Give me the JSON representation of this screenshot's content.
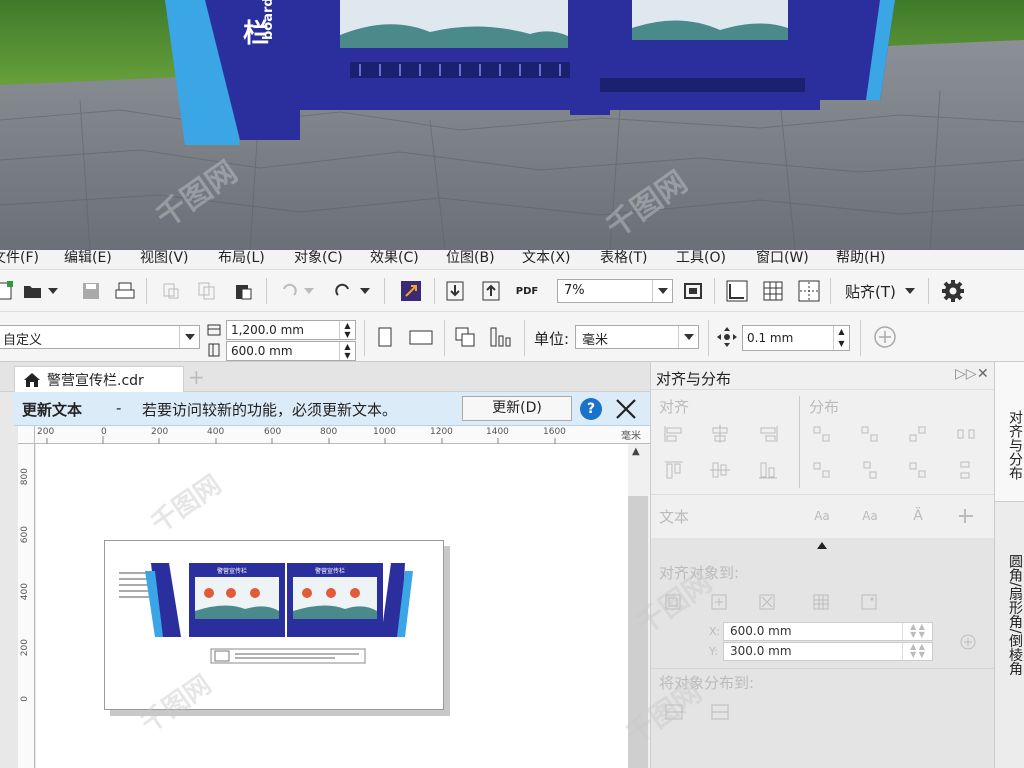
{
  "menu": [
    "文件(F)",
    "编辑(E)",
    "视图(V)",
    "布局(L)",
    "对象(C)",
    "效果(C)",
    "位图(B)",
    "文本(X)",
    "表格(T)",
    "工具(O)",
    "窗口(W)",
    "帮助(H)"
  ],
  "toolbar": {
    "zoom_value": "7%",
    "snap_label": "贴齐(T)"
  },
  "property_bar": {
    "page_size": "自定义",
    "width": "1,200.0 mm",
    "height": "600.0 mm",
    "unit_label": "单位:",
    "unit_value": "毫米",
    "nudge": "0.1 mm"
  },
  "document_tab": {
    "title": "警营宣传栏.cdr"
  },
  "notice": {
    "title": "更新文本",
    "dash": "-",
    "message": "若要访问较新的功能，必须更新文本。",
    "button": "更新(D)",
    "help": "?"
  },
  "ruler": {
    "unit": "毫米",
    "h_ticks": [
      "200",
      "0",
      "200",
      "400",
      "600",
      "800",
      "1000",
      "1200",
      "1400",
      "1600"
    ],
    "v_ticks": [
      "800",
      "600",
      "400",
      "200",
      "0"
    ]
  },
  "dock": {
    "title": "对齐与分布",
    "align_label": "对齐",
    "distribute_label": "分布",
    "text_label": "文本",
    "align_objects_to": "对齐对象到:",
    "x_label": "X:",
    "x_value": "600.0 mm",
    "y_label": "Y:",
    "y_value": "300.0 mm",
    "distribute_to": "将对象分布到:"
  },
  "side_tabs": [
    "对齐与分布",
    "圆角/扇形角/倒棱角"
  ],
  "billboard_text": {
    "side_char_left": "栏",
    "board_word": "board",
    "thumb_title_1": "警营宣传栏",
    "thumb_title_2": "警营宣传栏"
  },
  "colors": {
    "accent_blue": "#2b2f9e",
    "notice_bg": "#dcebf8",
    "help_blue": "#1a73c8"
  }
}
